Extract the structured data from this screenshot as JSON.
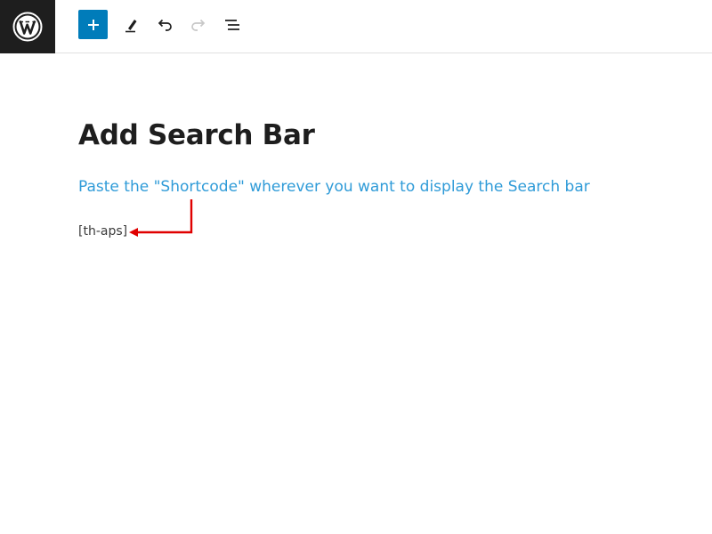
{
  "toolbar": {
    "logo_icon": "wordpress-logo-icon",
    "add_icon": "plus-icon",
    "tools_icon": "pencil-icon",
    "undo_icon": "undo-icon",
    "redo_icon": "redo-icon",
    "outline_icon": "list-view-icon",
    "accent_color": "#007cba"
  },
  "post": {
    "title": "Add Search Bar",
    "instruction": "Paste the \"Shortcode\" wherever you want to display the Search bar",
    "shortcode": "[th-aps]"
  },
  "colors": {
    "instruction_text": "#2f9bd8",
    "annotation_arrow": "#e00000"
  }
}
